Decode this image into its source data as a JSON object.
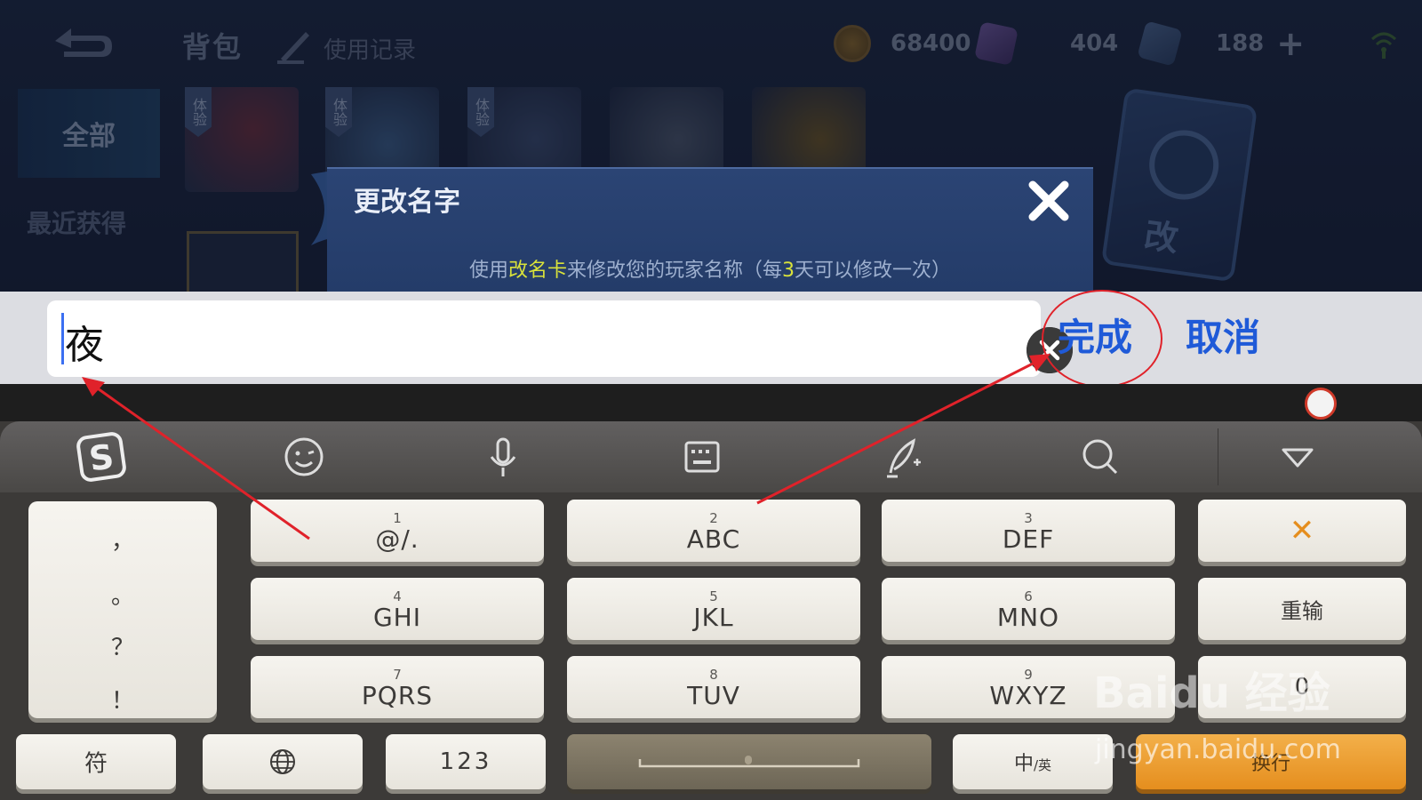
{
  "game": {
    "title": "背包",
    "history_label": "使用记录",
    "currencies": [
      {
        "icon": "gold-coin-icon",
        "value": "68400"
      },
      {
        "icon": "diamond-icon",
        "value": "404"
      },
      {
        "icon": "coupon-icon",
        "value": "188"
      }
    ],
    "add_symbol": "+",
    "sidebar": [
      {
        "label": "全部",
        "selected": true
      },
      {
        "label": "最近获得",
        "selected": false
      }
    ],
    "trial_tag": "体验",
    "rename_card_text": "改"
  },
  "dialog": {
    "title": "更改名字",
    "desc_pre": "使用",
    "desc_hl1": "改名卡",
    "desc_mid": "来修改您的玩家名称（每",
    "desc_hl2": "3",
    "desc_post": "天可以修改一次）"
  },
  "input": {
    "value": "夜",
    "done_label": "完成",
    "cancel_label": "取消"
  },
  "keyboard": {
    "punctuation": [
      "，",
      "。",
      "？",
      "！"
    ],
    "keys": [
      {
        "num": "1",
        "label": "@/."
      },
      {
        "num": "2",
        "label": "ABC"
      },
      {
        "num": "3",
        "label": "DEF"
      },
      {
        "num": "4",
        "label": "GHI"
      },
      {
        "num": "5",
        "label": "JKL"
      },
      {
        "num": "6",
        "label": "MNO"
      },
      {
        "num": "7",
        "label": "PQRS"
      },
      {
        "num": "8",
        "label": "TUV"
      },
      {
        "num": "9",
        "label": "WXYZ"
      }
    ],
    "delete_symbol": "✕",
    "retype_label": "重输",
    "zero_label": "0",
    "symbol_label": "符",
    "num_label": "123",
    "lang_main": "中",
    "lang_sub": "/英",
    "enter_label": "换行"
  },
  "watermark": {
    "line1": "Baidu 经验",
    "line2": "jingyan.baidu.com"
  },
  "colors": {
    "accent_blue": "#1f5ad8",
    "annotation_red": "#e0222a",
    "highlight_yellow": "#d9e23a",
    "enter_orange": "#e58e1e"
  }
}
